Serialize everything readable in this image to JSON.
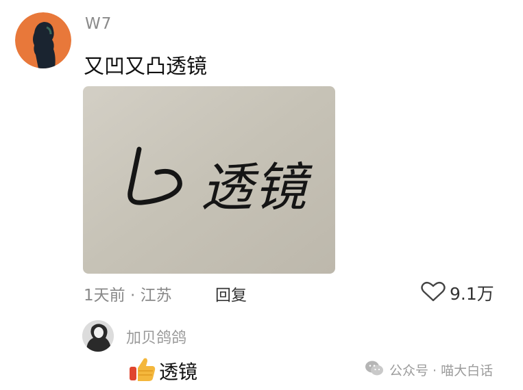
{
  "comment": {
    "username": "W7",
    "text": "又凹又凸透镜",
    "image_text": "凸透镜",
    "meta": "1天前 · 江苏",
    "reply_label": "回复",
    "like_count": "9.1万"
  },
  "reply": {
    "username": "加贝鸽鸽",
    "text": "透镜"
  },
  "watermark": {
    "text": "公众号 · 喵大白话"
  },
  "colors": {
    "avatar_bg": "#e8783a",
    "photo_paper": "#c9c5ba",
    "like_icon": "#444444"
  },
  "icons": [
    "heart-outline-icon",
    "thumbs-up-icon",
    "wechat-icon"
  ]
}
